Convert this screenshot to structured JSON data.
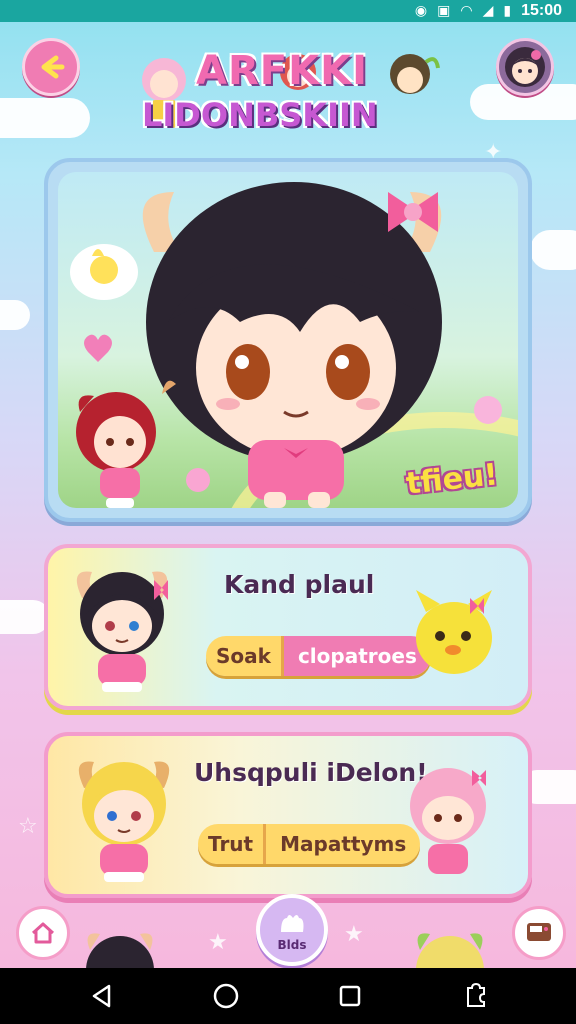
{
  "status_bar": {
    "time": "15:00"
  },
  "header": {
    "logo_line1": "ARFKKI",
    "logo_line2": "LIDONBSKIIN"
  },
  "hero": {
    "tag": "tfieu!"
  },
  "panels": [
    {
      "title": "Kand plaul",
      "pill_a": "Soak",
      "pill_b": "clopatroes"
    },
    {
      "title": "Uhsqpuli iDelon!",
      "pill_a": "Trut",
      "pill_b": "Mapattyms"
    }
  ],
  "bottom_nav": {
    "center_label": "Blds"
  },
  "colors": {
    "accent_pink": "#f07cb3",
    "accent_yellow": "#ffd86a",
    "status_teal": "#1aa6a0"
  }
}
